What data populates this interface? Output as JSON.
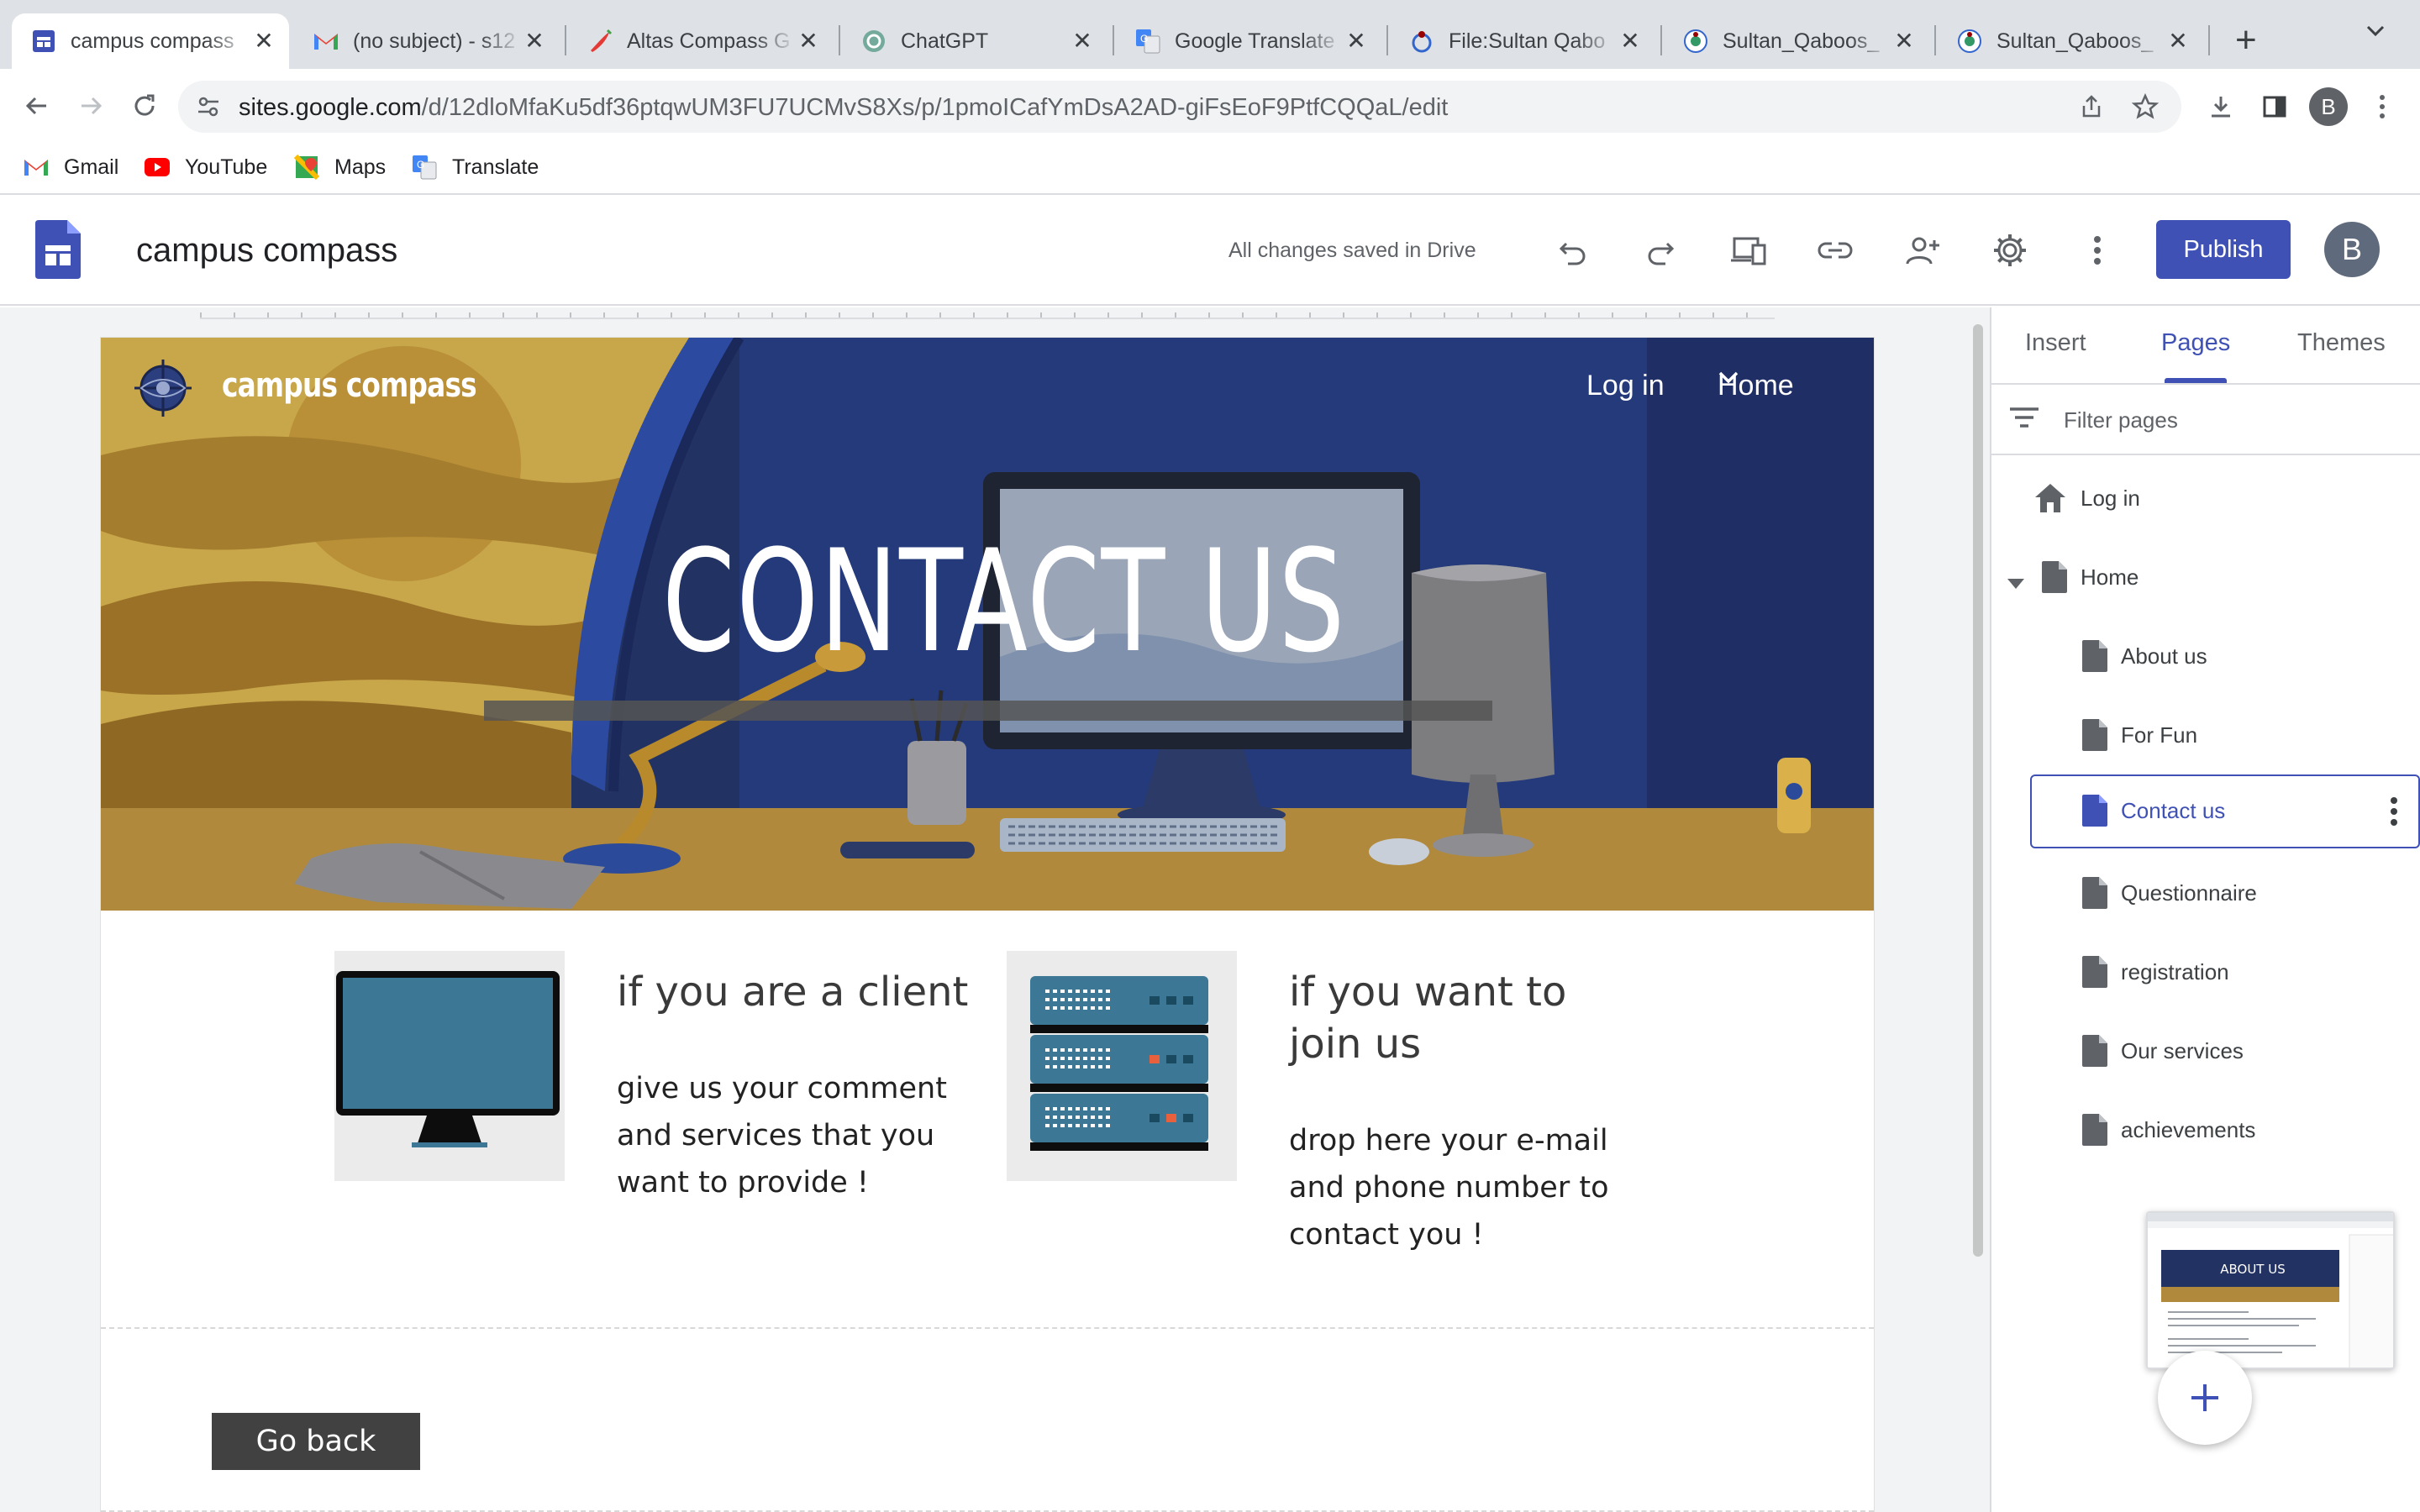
{
  "browser": {
    "tabs": [
      {
        "title": "campus compass",
        "favicon": "google-sites-icon",
        "active": true
      },
      {
        "title": "(no subject) - s12",
        "favicon": "gmail-icon"
      },
      {
        "title": "Altas Compass G",
        "favicon": "chili-icon"
      },
      {
        "title": "ChatGPT",
        "favicon": "chatgpt-icon"
      },
      {
        "title": "Google Translate",
        "favicon": "translate-icon"
      },
      {
        "title": "File:Sultan Qabo",
        "favicon": "wikimedia-icon"
      },
      {
        "title": "Sultan_Qaboos_",
        "favicon": "wikipedia-icon"
      },
      {
        "title": "Sultan_Qaboos_",
        "favicon": "wikipedia-icon"
      }
    ],
    "url_host": "sites.google.com",
    "url_path": "/d/12dloMfaKu5df36ptqwUM3FU7UCMvS8Xs/p/1pmoICafYmDsA2AD-giFsEoF9PtfCQQaL/edit",
    "profile_initial": "B",
    "bookmarks": [
      {
        "label": "Gmail",
        "icon": "gmail-icon"
      },
      {
        "label": "YouTube",
        "icon": "youtube-icon"
      },
      {
        "label": "Maps",
        "icon": "maps-icon"
      },
      {
        "label": "Translate",
        "icon": "translate-icon"
      }
    ]
  },
  "editor": {
    "site_name": "campus compass",
    "save_status": "All changes saved in Drive",
    "publish_label": "Publish",
    "user_initial": "B",
    "accent": "#3f51b5"
  },
  "site": {
    "brand": "campus compass",
    "nav": {
      "login": "Log in",
      "home": "Home"
    },
    "banner_title": "CONTACT US",
    "cards": [
      {
        "heading": "if you are a client",
        "body": "give us your comment and services that you want to provide !",
        "image": "monitor-icon"
      },
      {
        "heading": "if you want to join us",
        "body": "drop here your e-mail and phone number to contact you !",
        "image": "server-rack-icon"
      }
    ],
    "go_back": "Go back"
  },
  "panel": {
    "tabs": [
      "Insert",
      "Pages",
      "Themes"
    ],
    "active_tab": "Pages",
    "filter_placeholder": "Filter pages",
    "pages": [
      {
        "label": "Log in",
        "icon": "home-icon",
        "level": 0
      },
      {
        "label": "Home",
        "icon": "page-icon",
        "level": 0,
        "expanded": true
      },
      {
        "label": "About us",
        "icon": "page-icon",
        "level": 1
      },
      {
        "label": "For Fun",
        "icon": "page-icon",
        "level": 1
      },
      {
        "label": "Contact us",
        "icon": "page-icon",
        "level": 1,
        "selected": true
      },
      {
        "label": "Questionnaire",
        "icon": "page-icon",
        "level": 1
      },
      {
        "label": "registration",
        "icon": "page-icon",
        "level": 1
      },
      {
        "label": "Our services",
        "icon": "page-icon",
        "level": 1
      },
      {
        "label": "achievements",
        "icon": "page-icon",
        "level": 1
      }
    ],
    "preview_title": "ABOUT US"
  }
}
